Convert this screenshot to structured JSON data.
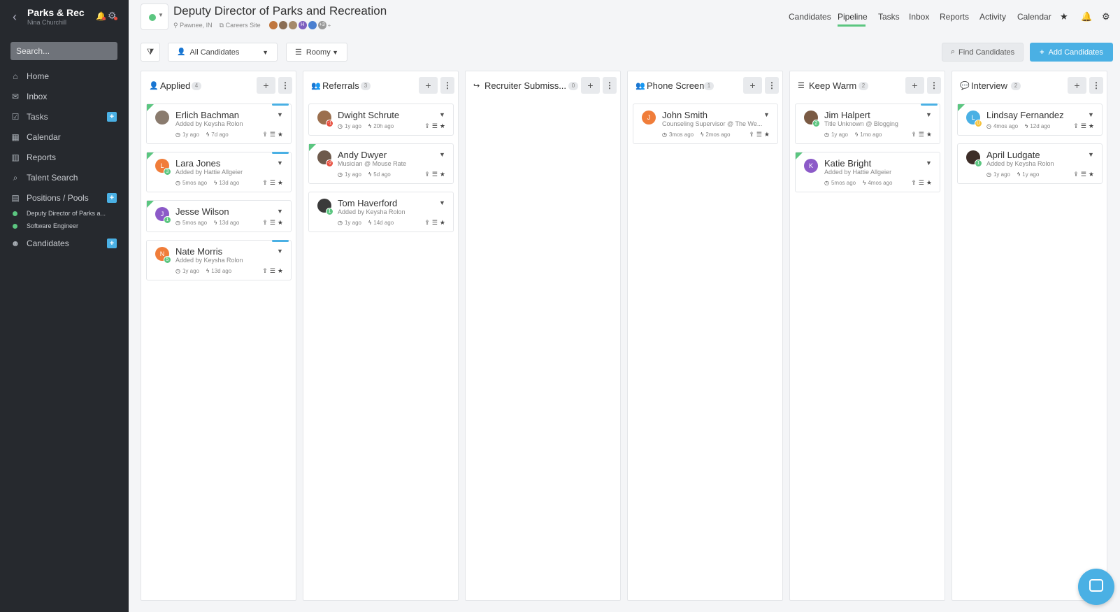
{
  "sidebar": {
    "title": "Parks & Rec",
    "user": "Nina Churchill",
    "search_placeholder": "Search...",
    "nav": [
      {
        "label": "Home",
        "icon": "home-icon",
        "glyph": "⌂"
      },
      {
        "label": "Inbox",
        "icon": "envelope-icon",
        "glyph": "✉"
      },
      {
        "label": "Tasks",
        "icon": "checkbox-icon",
        "glyph": "☑"
      },
      {
        "label": "Calendar",
        "icon": "calendar-icon",
        "glyph": "▦"
      },
      {
        "label": "Reports",
        "icon": "bar-chart-icon",
        "glyph": "▥"
      },
      {
        "label": "Talent Search",
        "icon": "search-icon",
        "glyph": "⌕"
      },
      {
        "label": "Positions / Pools",
        "icon": "briefcase-icon",
        "glyph": "▤"
      },
      {
        "label": "Candidates",
        "icon": "users-icon",
        "glyph": "☻"
      }
    ],
    "positions": [
      "Deputy Director of Parks a...",
      "Software Engineer"
    ]
  },
  "header": {
    "job_title": "Deputy Director of Parks and Recreation",
    "location": "Pawnee, IN",
    "careers_site": "Careers Site",
    "team_extra": "+3",
    "nav": [
      "Candidates",
      "Pipeline",
      "Tasks",
      "Inbox",
      "Reports",
      "Activity",
      "Calendar"
    ],
    "active_nav": "Pipeline"
  },
  "toolbar": {
    "candidate_filter": "All Candidates",
    "view_mode": "Roomy",
    "find_label": "Find Candidates",
    "add_label": "Add Candidates"
  },
  "columns": [
    {
      "name": "Applied",
      "count": "4",
      "icon": "user-icon",
      "glyph": "👤",
      "cards": [
        {
          "name": "Erlich Bachman",
          "sub": "Added by Keysha Rolon",
          "t1": "1y ago",
          "t2": "7d ago",
          "initial": "",
          "color": "#8a7b6e",
          "badge": "",
          "badge_color": "",
          "flag": true,
          "bluebar": true
        },
        {
          "name": "Lara Jones",
          "sub": "Added by Hattie Allgeier",
          "t1": "5mos ago",
          "t2": "13d ago",
          "initial": "L",
          "color": "#f07d3a",
          "badge": "3",
          "badge_color": "#5bc680",
          "flag": true,
          "bluebar": true
        },
        {
          "name": "Jesse Wilson",
          "sub": "",
          "t1": "5mos ago",
          "t2": "13d ago",
          "initial": "J",
          "color": "#8c5ac8",
          "badge": "1",
          "badge_color": "#5bc680",
          "flag": true,
          "bluebar": false
        },
        {
          "name": "Nate Morris",
          "sub": "Added by Keysha Rolon",
          "t1": "1y ago",
          "t2": "13d ago",
          "initial": "N",
          "color": "#f07d3a",
          "badge": "5",
          "badge_color": "#5bc680",
          "flag": false,
          "bluebar": true
        }
      ]
    },
    {
      "name": "Referrals",
      "count": "3",
      "icon": "users-icon",
      "glyph": "👥",
      "cards": [
        {
          "name": "Dwight Schrute",
          "sub": "",
          "t1": "1y ago",
          "t2": "20h ago",
          "initial": "",
          "color": "#9b6f4e",
          "badge": "-1",
          "badge_color": "#e74c3c",
          "flag": false,
          "bluebar": false
        },
        {
          "name": "Andy Dwyer",
          "sub": "Musician @ Mouse Rate",
          "t1": "1y ago",
          "t2": "5d ago",
          "initial": "",
          "color": "#6e5a4c",
          "badge": "-2",
          "badge_color": "#e74c3c",
          "flag": true,
          "bluebar": false
        },
        {
          "name": "Tom Haverford",
          "sub": "Added by Keysha Rolon",
          "t1": "1y ago",
          "t2": "14d ago",
          "initial": "",
          "color": "#3a3a3a",
          "badge": "1",
          "badge_color": "#5bc680",
          "flag": false,
          "bluebar": false
        }
      ]
    },
    {
      "name": "Recruiter Submiss...",
      "count": "0",
      "icon": "share-icon",
      "glyph": "↪",
      "cards": []
    },
    {
      "name": "Phone Screen",
      "count": "1",
      "icon": "users-icon",
      "glyph": "👥",
      "cards": [
        {
          "name": "John Smith",
          "sub": "Counseling Supervisor @ The We...",
          "t1": "3mos ago",
          "t2": "2mos ago",
          "initial": "J",
          "color": "#f07d3a",
          "badge": "",
          "badge_color": "",
          "flag": false,
          "bluebar": false
        }
      ]
    },
    {
      "name": "Keep Warm",
      "count": "2",
      "icon": "list-icon",
      "glyph": "☰",
      "cards": [
        {
          "name": "Jim Halpert",
          "sub": "Title Unknown @ Blogging",
          "t1": "1y ago",
          "t2": "1mo ago",
          "initial": "",
          "color": "#7a5a44",
          "badge": "2",
          "badge_color": "#5bc680",
          "flag": false,
          "bluebar": true
        },
        {
          "name": "Katie Bright",
          "sub": "Added by Hattie Allgeier",
          "t1": "5mos ago",
          "t2": "4mos ago",
          "initial": "K",
          "color": "#8c5ac8",
          "badge": "",
          "badge_color": "",
          "flag": true,
          "bluebar": false
        }
      ]
    },
    {
      "name": "Interview",
      "count": "2",
      "icon": "chat-icon",
      "glyph": "💬",
      "cards": [
        {
          "name": "Lindsay Fernandez",
          "sub": "",
          "t1": "4mos ago",
          "t2": "12d ago",
          "initial": "L",
          "color": "#4ab0e4",
          "badge": "U",
          "badge_color": "#f5c13a",
          "flag": true,
          "bluebar": false
        },
        {
          "name": "April Ludgate",
          "sub": "Added by Keysha Rolon",
          "t1": "1y ago",
          "t2": "1y ago",
          "initial": "",
          "color": "#3d2e28",
          "badge": "1",
          "badge_color": "#5bc680",
          "flag": false,
          "bluebar": false
        }
      ]
    }
  ]
}
